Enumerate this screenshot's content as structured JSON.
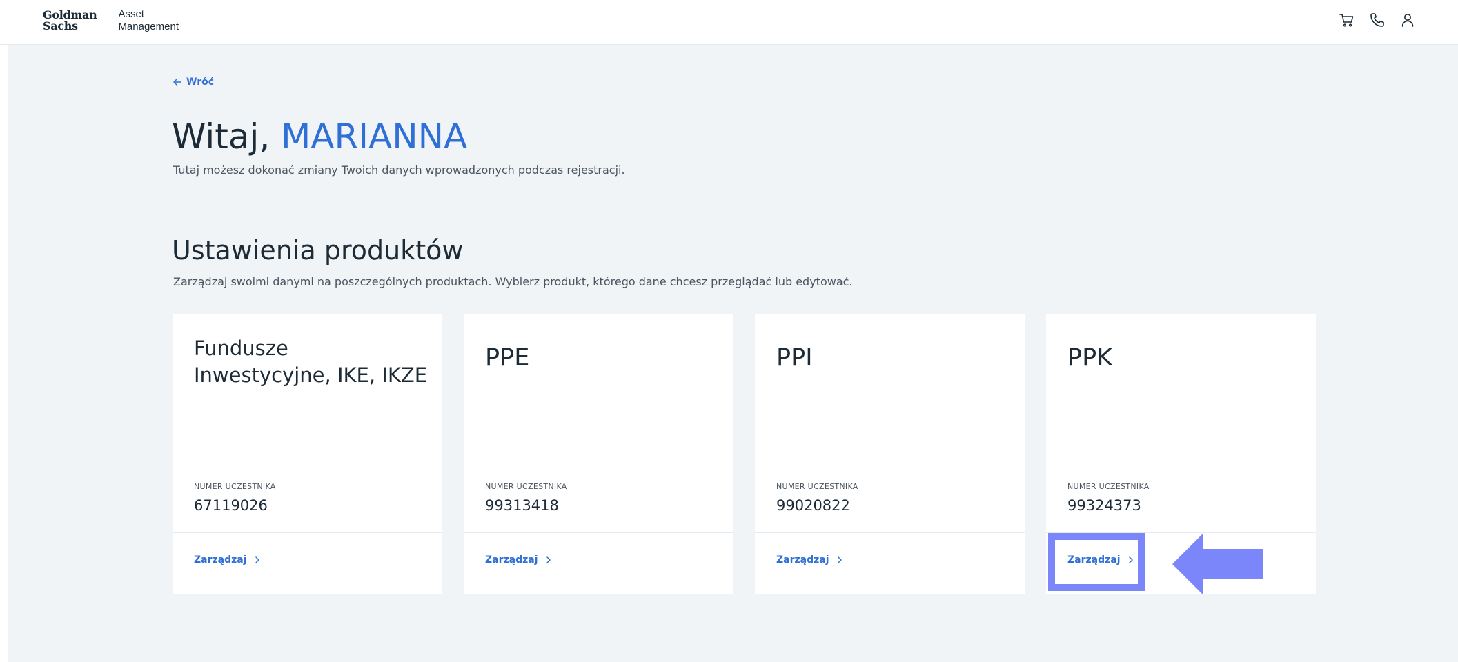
{
  "header": {
    "logo_line1": "Goldman",
    "logo_line2": "Sachs",
    "logo_am_line1": "Asset",
    "logo_am_line2": "Management",
    "icons": [
      "cart-icon",
      "phone-icon",
      "user-icon"
    ]
  },
  "back_label": "Wrόć",
  "greeting": {
    "prefix": "Witaj, ",
    "name": "MARIANNA",
    "subtitle": "Tutaj możesz dokonać zmiany Twoich danych wprowadzonych podczas rejestracji."
  },
  "products": {
    "title": "Ustawienia produktów",
    "description": "Zarządzaj swoimi danymi na poszczególnych produktach. Wybierz produkt, którego dane chcesz przeglądać lub edytować.",
    "cards": [
      {
        "title": "Fundusze Inwestycyjne, IKE, IKZE",
        "number_label": "NUMER UCZESTNIKA",
        "number": "67119026",
        "manage_label": "Zarządzaj"
      },
      {
        "title": "PPE",
        "number_label": "NUMER UCZESTNIKA",
        "number": "99313418",
        "manage_label": "Zarządzaj"
      },
      {
        "title": "PPI",
        "number_label": "NUMER UCZESTNIKA",
        "number": "99020822",
        "manage_label": "Zarządzaj"
      },
      {
        "title": "PPK",
        "number_label": "NUMER UCZESTNIKA",
        "number": "99324373",
        "manage_label": "Zarządzaj"
      }
    ]
  },
  "colors": {
    "accent": "#2f6fd6",
    "background": "#f1f4f7",
    "annotation": "#7b86fb"
  }
}
